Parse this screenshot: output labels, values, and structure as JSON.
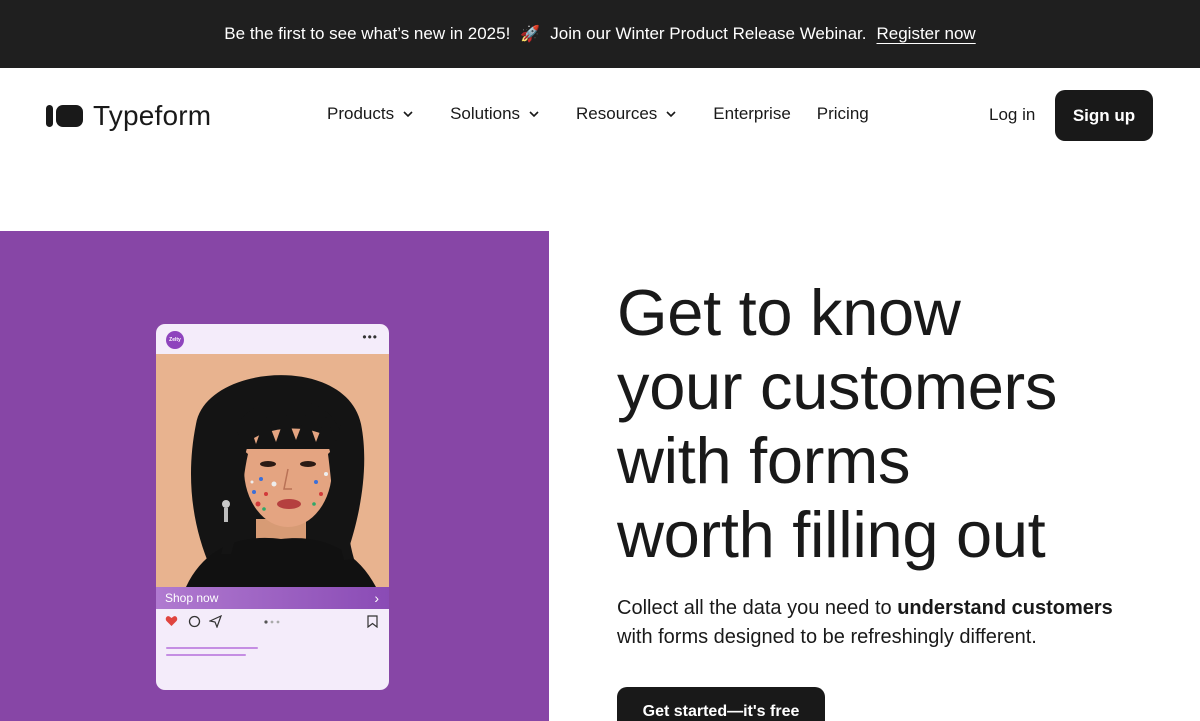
{
  "announcement": {
    "text_before": "Be the first to see what’s new in 2025!",
    "rocket_icon": "🚀",
    "text_after": "Join our Winter Product Release Webinar.",
    "link_label": "Register now"
  },
  "nav": {
    "logo_text": "Typeform",
    "items": [
      {
        "label": "Products",
        "has_dropdown": true
      },
      {
        "label": "Solutions",
        "has_dropdown": true
      },
      {
        "label": "Resources",
        "has_dropdown": true
      },
      {
        "label": "Enterprise",
        "has_dropdown": false
      },
      {
        "label": "Pricing",
        "has_dropdown": false
      }
    ],
    "login_label": "Log in",
    "signup_label": "Sign up"
  },
  "hero": {
    "headline_lines": [
      "Get to know",
      "your customers",
      "with forms",
      "worth filling out"
    ],
    "sub_plain_1": "Collect all the data you need to ",
    "sub_bold": "understand customers",
    "sub_plain_2": "with forms designed to be refreshingly different.",
    "cta_label": "Get started—it's free",
    "card": {
      "brand_badge": "Zelty",
      "shop_label": "Shop now"
    }
  },
  "colors": {
    "announcement_bg": "#1f1f1f",
    "hero_panel": "#8746a6",
    "button_dark": "#191919",
    "card_bg": "#f4ecfa"
  }
}
